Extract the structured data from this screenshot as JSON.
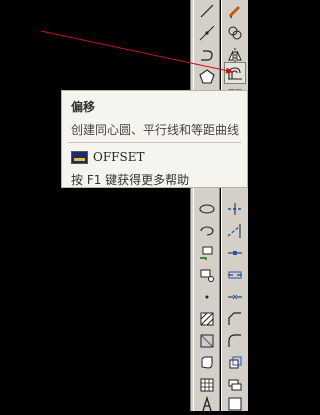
{
  "tooltip": {
    "title": "偏移",
    "description": "创建同心圆、平行线和等距曲线",
    "command": "OFFSET",
    "help": "按 F1 键获得更多帮助"
  },
  "colors": {
    "canvas": "#000000",
    "toolbar": "#d4d0c8",
    "annotation_arrow": "#cc1111",
    "tooltip_bg": "#f6f4ee"
  },
  "toolbar": {
    "draw_tools": [
      "line-icon",
      "construction-line-icon",
      "polyline-icon",
      "polygon-icon",
      "rectangle-icon",
      "arc-icon",
      "circle-icon",
      "revision-cloud-icon",
      "spline-icon",
      "ellipse-icon",
      "ellipse-arc-icon",
      "insert-block-icon",
      "make-block-icon",
      "point-icon",
      "hatch-icon",
      "gradient-icon",
      "region-icon",
      "table-icon",
      "multiline-text-icon"
    ],
    "modify_tools": [
      "erase-icon",
      "copy-icon",
      "mirror-icon",
      "offset-icon",
      "array-icon",
      "move-icon",
      "rotate-icon",
      "scale-icon",
      "stretch-icon",
      "trim-icon",
      "extend-icon",
      "break-at-point-icon",
      "break-icon",
      "join-icon",
      "chamfer-icon",
      "fillet-icon",
      "explode-icon"
    ]
  }
}
